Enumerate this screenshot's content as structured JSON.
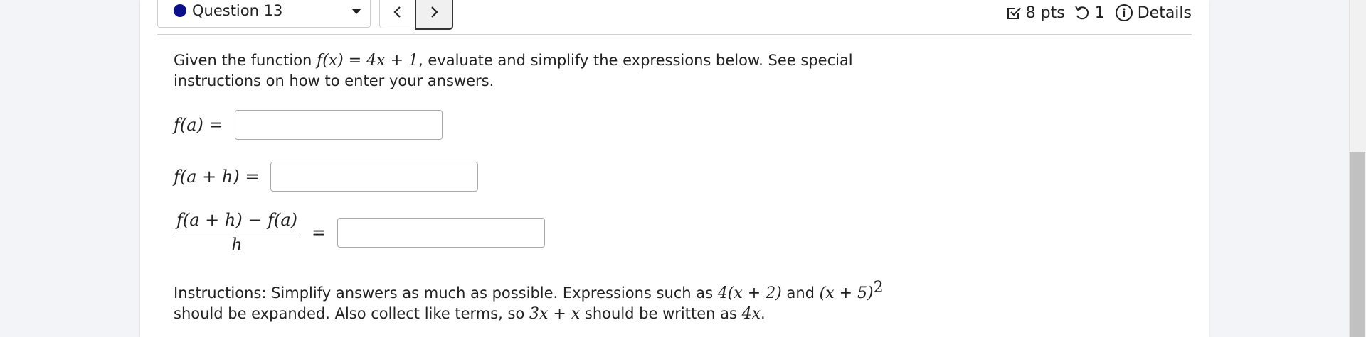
{
  "header": {
    "question_label": "Question 13",
    "points": "8 pts",
    "tries": "1",
    "details_label": "Details"
  },
  "problem": {
    "intro_before": "Given the function ",
    "function_def": "f(x) = 4x + 1",
    "intro_after": ", evaluate and simplify the expressions below. See special instructions on how to enter your answers."
  },
  "answers": [
    {
      "label": "f(a) =",
      "value": ""
    },
    {
      "label": "f(a + h) =",
      "value": ""
    },
    {
      "numerator": "f(a + h) − f(a)",
      "denominator": "h",
      "equals": "=",
      "value": ""
    }
  ],
  "instructions": {
    "part1": "Instructions: Simplify answers as much as possible. Expressions such as ",
    "expr1": "4(x + 2)",
    "part2": " and ",
    "expr2": "(x + 5)",
    "expr2_exp": "2",
    "part3": " should be expanded. Also collect like terms, so ",
    "expr3": "3x + x",
    "part4": " should be written as ",
    "expr4": "4x",
    "part5": "."
  },
  "colors": {
    "status_dot": "#0b0f8a",
    "background": "#f3f4f8",
    "card": "#ffffff"
  },
  "icons": {
    "status": "status-dot-icon",
    "dropdown": "caret-down-icon",
    "prev": "chevron-left-icon",
    "next": "chevron-right-icon",
    "points": "checkbox-icon",
    "tries": "retry-icon",
    "details": "info-icon"
  }
}
